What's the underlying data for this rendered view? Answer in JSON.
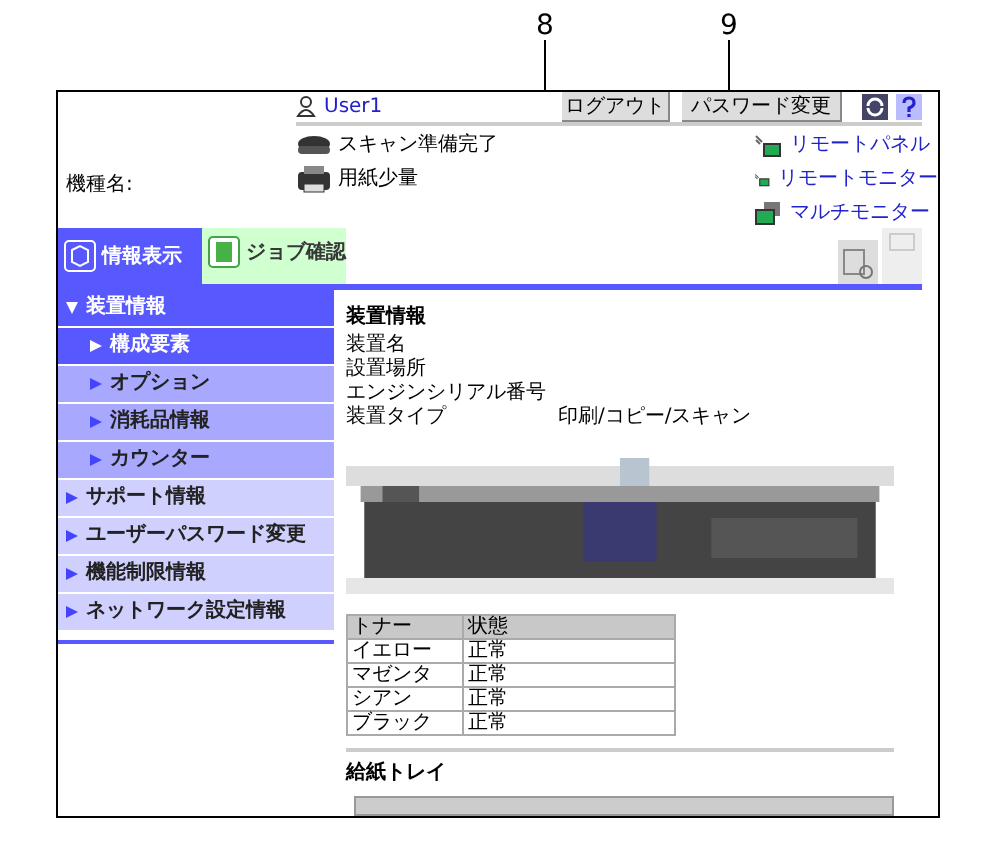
{
  "callouts": [
    {
      "label": "8"
    },
    {
      "label": "9"
    }
  ],
  "header": {
    "user": "User1",
    "logout_button": "ログアウト",
    "password_button": "パスワード変更",
    "machine_name_label": "機種名:"
  },
  "status": [
    {
      "kind": "scanner",
      "text": "スキャン準備完了"
    },
    {
      "kind": "printer",
      "text": "用紙少量"
    }
  ],
  "links": [
    {
      "kind": "remote",
      "text": "リモートパネル"
    },
    {
      "kind": "remote",
      "text": "リモートモニター"
    },
    {
      "kind": "multi",
      "text": "マルチモニター"
    }
  ],
  "tabs": [
    {
      "kind": "info",
      "label": "情報表示",
      "selected": true
    },
    {
      "kind": "job",
      "label": "ジョブ確認",
      "selected": false
    }
  ],
  "sidebar": {
    "items": [
      {
        "label": "装置情報",
        "expanded": true,
        "children": [
          {
            "label": "構成要素",
            "selected": true
          },
          {
            "label": "オプション",
            "selected": false
          },
          {
            "label": "消耗品情報",
            "selected": false
          },
          {
            "label": "カウンター",
            "selected": false
          }
        ]
      },
      {
        "label": "サポート情報",
        "expanded": false,
        "selected": false
      },
      {
        "label": "ユーザーパスワード変更",
        "expanded": false,
        "selected": false
      },
      {
        "label": "機能制限情報",
        "expanded": false,
        "selected": false
      },
      {
        "label": "ネットワーク設定情報",
        "expanded": false,
        "selected": false
      }
    ]
  },
  "device_info": {
    "title": "装置情報",
    "fields": [
      {
        "label": "装置名"
      },
      {
        "label": "設置場所"
      },
      {
        "label": "エンジンシリアル番号"
      },
      {
        "label": "装置タイプ",
        "value": "印刷/コピー/スキャン"
      }
    ]
  },
  "toner_table": {
    "columns": [
      "トナー",
      "状態"
    ],
    "rows": [
      [
        "イエロー",
        "正常"
      ],
      [
        "マゼンタ",
        "正常"
      ],
      [
        "シアン",
        "正常"
      ],
      [
        "ブラック",
        "正常"
      ]
    ]
  },
  "paper_tray": {
    "title": "給紙トレイ"
  }
}
